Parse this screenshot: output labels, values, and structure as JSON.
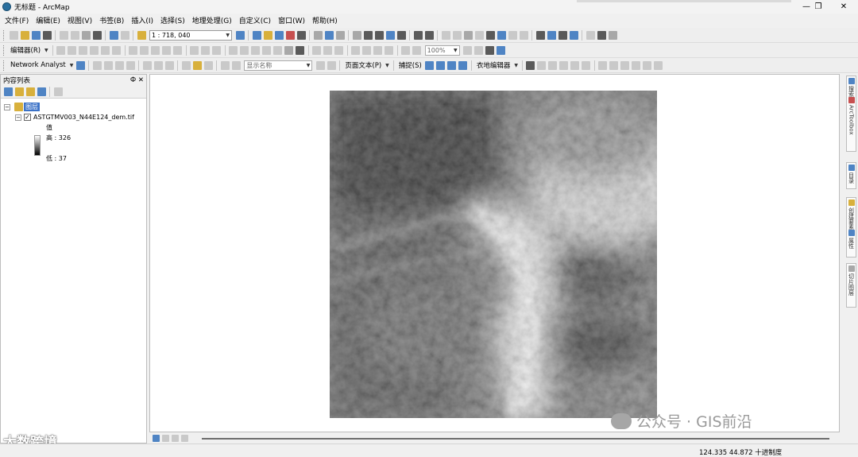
{
  "window": {
    "title": "无标题 - ArcMap",
    "min_label": "—",
    "max_label": "❐",
    "close_label": "✕"
  },
  "menu": [
    "文件(F)",
    "编辑(E)",
    "视图(V)",
    "书签(B)",
    "插入(I)",
    "选择(S)",
    "地理处理(G)",
    "自定义(C)",
    "窗口(W)",
    "帮助(H)"
  ],
  "toolbar": {
    "scale": "1 : 718, 040",
    "editor": "编辑器(R)",
    "zoom": "100%",
    "network_analyst": "Network Analyst",
    "display_name": "显示名称",
    "page_text": "页面文本(P)",
    "snapping": "捕捉(S)",
    "georef": "衣地编辑器"
  },
  "toc": {
    "title": "内容列表",
    "pin": "Ф",
    "close": "✕",
    "layers_label": "图层",
    "layer_name": "ASTGTMV003_N44E124_dem.tif",
    "legend_title": "值",
    "high_label": "高 : 326",
    "low_label": "低 : 37"
  },
  "right_panels": [
    "搜索",
    "ArcToolbox",
    "目录",
    "创建要素",
    "属性",
    "切片图层"
  ],
  "watermark": {
    "main": "公众号 · GIS前沿",
    "corner": "大数跨境"
  },
  "status": {
    "coords": "124.335  44.872 十进制度"
  }
}
